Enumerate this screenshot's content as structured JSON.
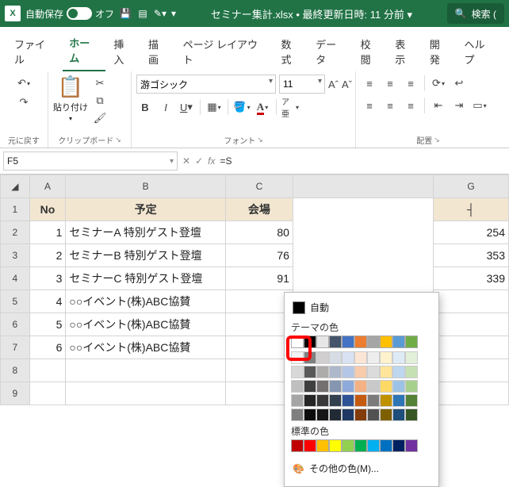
{
  "titlebar": {
    "autosave_label": "自動保存",
    "autosave_state": "オフ",
    "filename": "セミナー集計.xlsx • 最終更新日時: 11 分前 ▾",
    "search_label": "検索 ("
  },
  "tabs": {
    "file": "ファイル",
    "home": "ホーム",
    "insert": "挿入",
    "draw": "描画",
    "layout": "ページ レイアウト",
    "formulas": "数式",
    "data": "データ",
    "review": "校閲",
    "view": "表示",
    "dev": "開発",
    "help": "ヘルプ"
  },
  "ribbon": {
    "undo_group": "元に戻す",
    "paste_label": "貼り付け",
    "clipboard_group": "クリップボード",
    "font_name": "游ゴシック",
    "font_size": "11",
    "font_group": "フォント",
    "align_group": "配置"
  },
  "namebox": "F5",
  "formula_prefix": "=S",
  "headers": {
    "A": "No",
    "B": "予定",
    "C": "会場",
    "G": ""
  },
  "rows": [
    {
      "a": "1",
      "b": "セミナーA 特別ゲスト登壇",
      "c": "80",
      "g": "254"
    },
    {
      "a": "2",
      "b": "セミナーB  特別ゲスト登壇",
      "c": "76",
      "g": "353"
    },
    {
      "a": "3",
      "b": "セミナーC 特別ゲスト登壇",
      "c": "91",
      "g": "339"
    },
    {
      "a": "4",
      "b": "○○イベント(株)ABC協賛",
      "c": "",
      "g": ""
    },
    {
      "a": "5",
      "b": "○○イベント(株)ABC協賛",
      "c": "",
      "g": ""
    },
    {
      "a": "6",
      "b": "○○イベント(株)ABC協賛",
      "c": "",
      "g": ""
    }
  ],
  "colorpop": {
    "auto": "自動",
    "theme": "テーマの色",
    "standard": "標準の色",
    "more": "その他の色(M)...",
    "theme_row1": [
      "#ffffff",
      "#000000",
      "#e7e6e6",
      "#44546a",
      "#4472c4",
      "#ed7d31",
      "#a5a5a5",
      "#ffc000",
      "#5b9bd5",
      "#70ad47"
    ],
    "theme_shades": [
      [
        "#f2f2f2",
        "#7f7f7f",
        "#d0cece",
        "#d6dce4",
        "#d9e2f3",
        "#fbe5d5",
        "#ededed",
        "#fff2cc",
        "#deebf6",
        "#e2efd9"
      ],
      [
        "#d8d8d8",
        "#595959",
        "#aeabab",
        "#adb9ca",
        "#b4c6e7",
        "#f7cbac",
        "#dbdbdb",
        "#fee599",
        "#bdd7ee",
        "#c5e0b3"
      ],
      [
        "#bfbfbf",
        "#3f3f3f",
        "#757070",
        "#8496b0",
        "#8eaadb",
        "#f4b183",
        "#c9c9c9",
        "#ffd965",
        "#9cc3e5",
        "#a8d08d"
      ],
      [
        "#a5a5a5",
        "#262626",
        "#3a3838",
        "#323f4f",
        "#2f5496",
        "#c55a11",
        "#7b7b7b",
        "#bf9000",
        "#2e75b5",
        "#538135"
      ],
      [
        "#7f7f7f",
        "#0c0c0c",
        "#171616",
        "#222a35",
        "#1f3864",
        "#833c0b",
        "#525252",
        "#7f6000",
        "#1e4e79",
        "#375623"
      ]
    ],
    "standard_row": [
      "#c00000",
      "#ff0000",
      "#ffc000",
      "#ffff00",
      "#92d050",
      "#00b050",
      "#00b0f0",
      "#0070c0",
      "#002060",
      "#7030a0"
    ]
  }
}
